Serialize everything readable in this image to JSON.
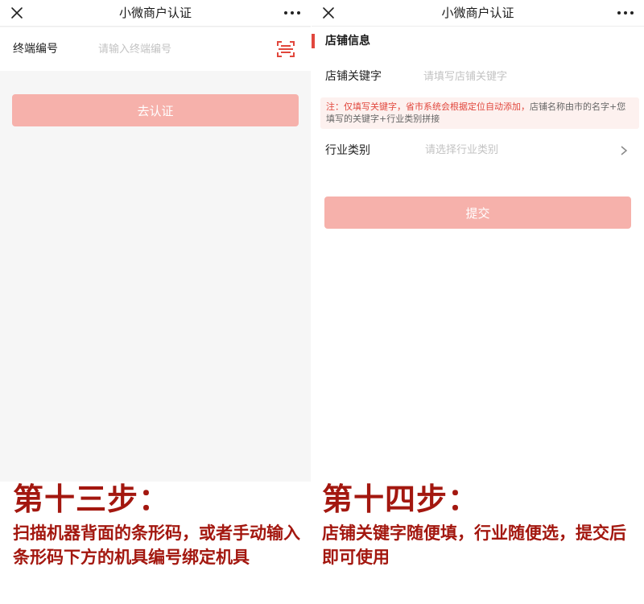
{
  "left_screen": {
    "navbar": {
      "title": "小微商户认证"
    },
    "terminal": {
      "label": "终端编号",
      "placeholder": "请输入终端编号",
      "value": ""
    },
    "verify_button": "去认证"
  },
  "right_screen": {
    "navbar": {
      "title": "小微商户认证"
    },
    "section_title": "店铺信息",
    "keyword": {
      "label": "店铺关键字",
      "placeholder": "请填写店铺关键字",
      "value": ""
    },
    "notice": {
      "highlight": "注：仅填写关键字，省市系统会根据定位自动添加，",
      "rest": "店铺名称由市的名字+您填写的关键字+行业类别拼接"
    },
    "industry": {
      "label": "行业类别",
      "placeholder": "请选择行业类别"
    },
    "submit_button": "提交"
  },
  "captions": {
    "left_title": "第十三步：",
    "left_desc": "扫描机器背面的条形码，或者手动输入条形码下方的机具编号绑定机具",
    "right_title": "第十四步：",
    "right_desc": "店铺关键字随便填，行业随便选，提交后即可使用"
  },
  "icons": {
    "close": "close-icon",
    "more": "more-dots-icon",
    "scan": "scan-icon",
    "chevron": "chevron-right-icon"
  },
  "colors": {
    "accent": "#e1473d",
    "button_disabled": "#f6b1ab",
    "caption": "#a3170f",
    "notice_bg": "#fdf1ef"
  }
}
